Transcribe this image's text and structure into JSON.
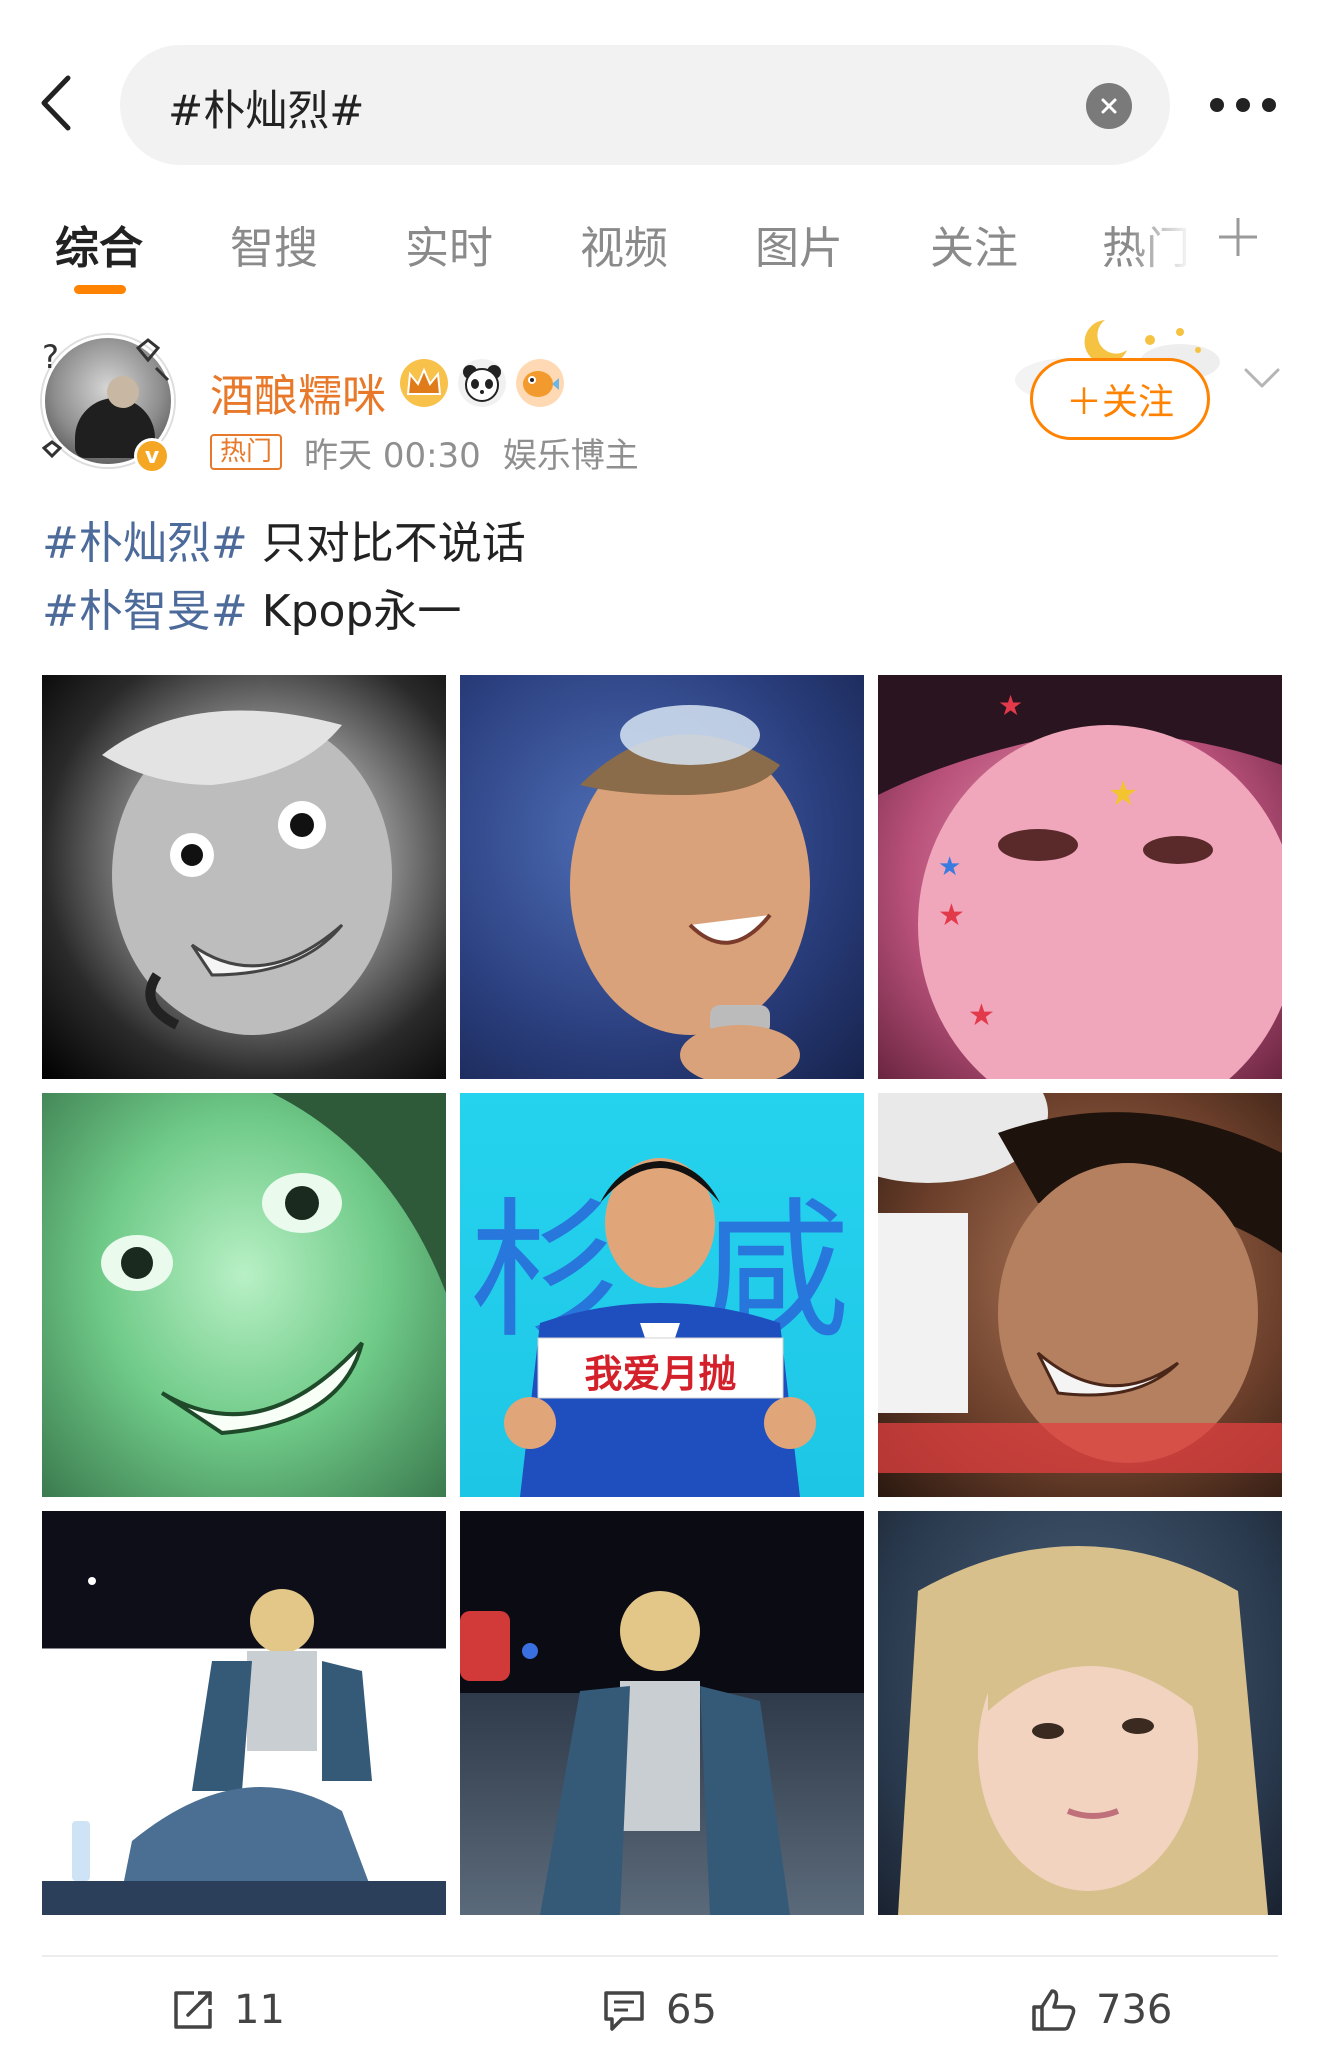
{
  "search": {
    "query": "#朴灿烈#"
  },
  "tabs": [
    {
      "label": "综合",
      "active": true
    },
    {
      "label": "智搜",
      "active": false
    },
    {
      "label": "实时",
      "active": false
    },
    {
      "label": "视频",
      "active": false
    },
    {
      "label": "图片",
      "active": false
    },
    {
      "label": "关注",
      "active": false
    },
    {
      "label": "热门",
      "active": false
    }
  ],
  "post": {
    "author": {
      "name": "酒酿糯咪",
      "verified": true,
      "badges": [
        "crown-badge-icon",
        "panda-badge-icon",
        "pufferfish-badge-icon"
      ]
    },
    "hot_tag": "热门",
    "time": "昨天 00:30",
    "source": "娱乐博主",
    "follow_label": "＋关注",
    "text_lines": [
      {
        "hashtag": "#朴灿烈#",
        "text": " 只对比不说话"
      },
      {
        "hashtag": "#朴智旻#",
        "text": " Kpop永一"
      }
    ],
    "images": [
      {
        "subject": "grayscale-wide-eyed-smile-photo"
      },
      {
        "subject": "blue-stage-singer-with-microphone-photo"
      },
      {
        "subject": "pink-close-up-with-star-stickers-photo"
      },
      {
        "subject": "green-tinted-grin-photo"
      },
      {
        "subject": "cyan-meme-thumbs-up-photo",
        "caption": "我爱月抛"
      },
      {
        "subject": "laughing-close-up-photo"
      },
      {
        "subject": "blonde-performer-seated-on-stage-photo"
      },
      {
        "subject": "blonde-performer-standing-on-stage-photo"
      },
      {
        "subject": "blonde-performer-close-up-photo"
      }
    ],
    "actions": {
      "repost_count": "11",
      "comment_count": "65",
      "like_count": "736"
    }
  },
  "colors": {
    "accent": "#ff8200",
    "username": "#e8792a",
    "hashtag": "#4c6a9a",
    "muted": "#8f8f8f"
  }
}
